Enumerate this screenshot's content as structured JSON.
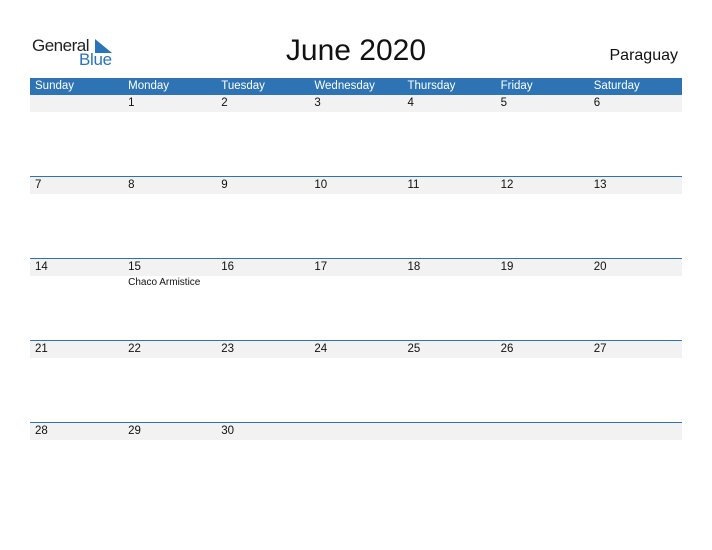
{
  "logo": {
    "general": "General",
    "blue": "Blue",
    "icon": "triangle-flag-icon"
  },
  "title": "June 2020",
  "country": "Paraguay",
  "weekdays": [
    "Sunday",
    "Monday",
    "Tuesday",
    "Wednesday",
    "Thursday",
    "Friday",
    "Saturday"
  ],
  "weeks": [
    {
      "days": [
        "",
        "1",
        "2",
        "3",
        "4",
        "5",
        "6"
      ],
      "events": [
        "",
        "",
        "",
        "",
        "",
        "",
        ""
      ]
    },
    {
      "days": [
        "7",
        "8",
        "9",
        "10",
        "11",
        "12",
        "13"
      ],
      "events": [
        "",
        "",
        "",
        "",
        "",
        "",
        ""
      ]
    },
    {
      "days": [
        "14",
        "15",
        "16",
        "17",
        "18",
        "19",
        "20"
      ],
      "events": [
        "",
        "Chaco Armistice",
        "",
        "",
        "",
        "",
        ""
      ]
    },
    {
      "days": [
        "21",
        "22",
        "23",
        "24",
        "25",
        "26",
        "27"
      ],
      "events": [
        "",
        "",
        "",
        "",
        "",
        "",
        ""
      ]
    },
    {
      "days": [
        "28",
        "29",
        "30",
        "",
        "",
        "",
        ""
      ],
      "events": [
        "",
        "",
        "",
        "",
        "",
        "",
        ""
      ]
    }
  ],
  "colors": {
    "header": "#2e74b5",
    "daybar": "#f2f2f2",
    "brand_blue": "#2a74b8"
  }
}
